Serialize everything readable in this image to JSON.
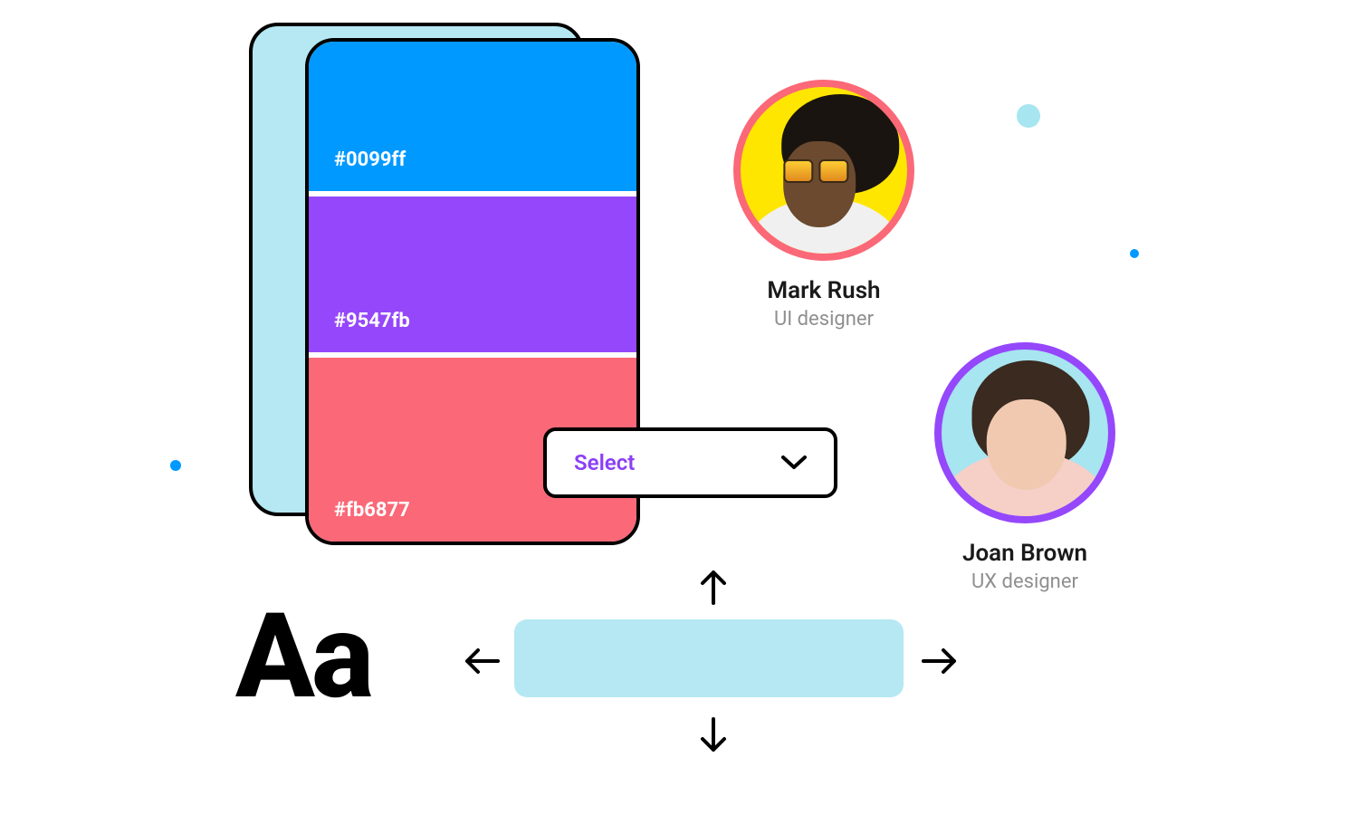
{
  "palette": {
    "swatches": [
      {
        "hex": "#0099ff"
      },
      {
        "hex": "#9547fb"
      },
      {
        "hex": "#fb6877"
      }
    ]
  },
  "select": {
    "label": "Select"
  },
  "people": [
    {
      "name": "Mark Rush",
      "role": "UI designer"
    },
    {
      "name": "Joan Brown",
      "role": "UX designer"
    }
  ],
  "typography": {
    "sample": "Aa"
  }
}
